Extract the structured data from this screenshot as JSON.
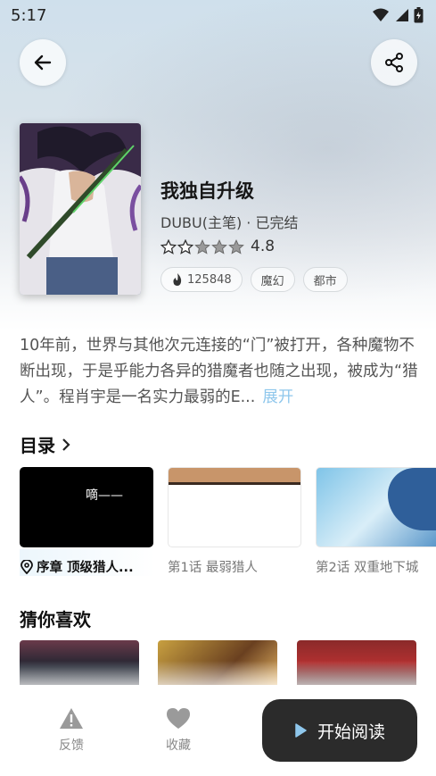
{
  "status_bar": {
    "time": "5:17"
  },
  "book": {
    "title": "我独自升级",
    "author": "DUBU(主笔) · 已完结",
    "rating": "4.8",
    "rating_stars": 4.8,
    "tags": [
      {
        "label": "125848",
        "icon": "flame-icon"
      },
      {
        "label": "魔幻"
      },
      {
        "label": "都市"
      }
    ],
    "synopsis": "10年前，世界与其他次元连接的“门”被打开，各种魔物不断出现，于是乎能力各异的猎魔者也随之出现，被成为“猎人”。程肖宇是一名实力最弱的E...",
    "expand_label": "展开"
  },
  "toc": {
    "title": "目录",
    "chapters": [
      {
        "label": "序章 顶级猎人...",
        "current": true,
        "thumb_text": "嘀——"
      },
      {
        "label": "第1话  最弱猎人"
      },
      {
        "label": "第2话  双重地下城"
      }
    ]
  },
  "recommend": {
    "title": "猜你喜欢"
  },
  "bottom_bar": {
    "feedback_label": "反馈",
    "favorite_label": "收藏",
    "read_label": "开始阅读"
  },
  "colors": {
    "accent": "#8fc7ec",
    "button_dark": "#2b2b2b"
  }
}
